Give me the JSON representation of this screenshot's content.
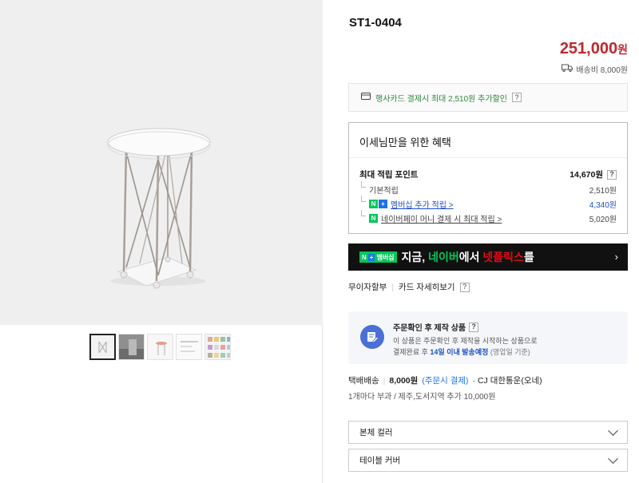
{
  "product": {
    "code": "ST1-0404",
    "price": "251,000",
    "currency": "원",
    "shipping_fee_label": "배송비 8,000원"
  },
  "card_banner": {
    "text": "행사카드 결제시 최대 2,510원 추가할인",
    "help": "?"
  },
  "benefit": {
    "title": "이세님만을 위한 혜택",
    "max_points_label": "최대 적립 포인트",
    "max_points_value": "14,670원",
    "help": "?",
    "rows": [
      {
        "label": "기본적립",
        "value": "2,510원"
      },
      {
        "label": "멤버십 추가 적립 >",
        "value": "4,340원"
      },
      {
        "label": "네이버페이 머니 결제 시 최대 적립 >",
        "value": "5,020원"
      }
    ]
  },
  "netflix_banner": {
    "tag": "멤버십",
    "text_prefix": "지금, ",
    "text_green": "네이버",
    "text_mid": "에서 ",
    "text_red": "넷플릭스",
    "text_suffix": "를",
    "arrow": "›"
  },
  "payment": {
    "installment": "무이자할부",
    "card_detail": "카드 자세히보기",
    "help": "?"
  },
  "order_info": {
    "title": "주문확인 후 제작 상품",
    "help": "?",
    "line1": "이 상품은 주문확인 후 제작을 시작하는 상품으로",
    "line2_prefix": "결제완료 후 ",
    "line2_highlight": "14일 이내 발송예정",
    "line2_suffix": " (영업일 기준)"
  },
  "delivery": {
    "method": "택배배송",
    "fee": "8,000원",
    "fee_note": "(주문시 결제)",
    "courier": "· CJ 대한통운(오네)",
    "extra": "1개마다 부과 / 제주,도서지역 추가 10,000원"
  },
  "options": [
    {
      "label": "본체 컬러"
    },
    {
      "label": "테이블 커버"
    }
  ],
  "colors": {
    "price": "#c0272d",
    "naver_green": "#03c75a",
    "link_blue": "#1e4fc7"
  }
}
